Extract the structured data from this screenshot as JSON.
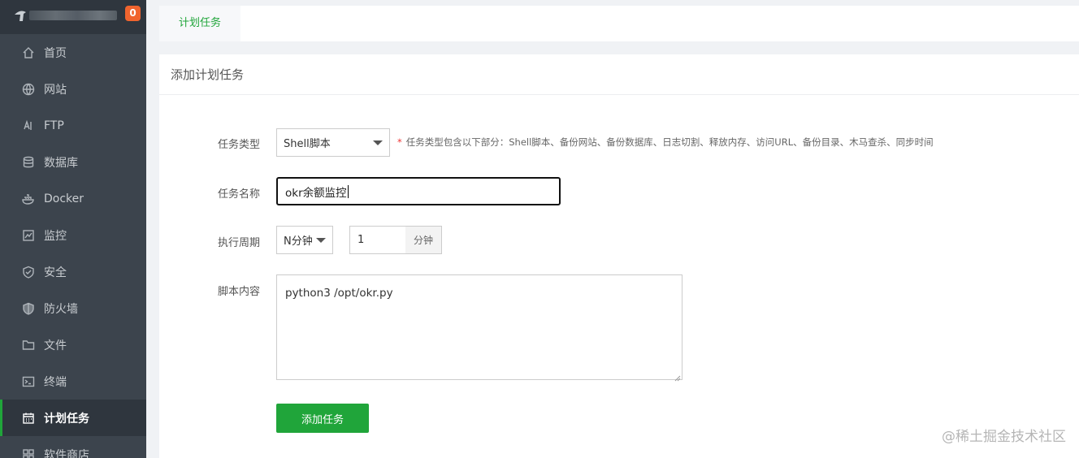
{
  "sidebar": {
    "badge": "0",
    "items": [
      {
        "label": "首页",
        "icon": "home-icon",
        "name": "sidebar-item-home"
      },
      {
        "label": "网站",
        "icon": "globe-icon",
        "name": "sidebar-item-website"
      },
      {
        "label": "FTP",
        "icon": "ftp-icon",
        "name": "sidebar-item-ftp"
      },
      {
        "label": "数据库",
        "icon": "database-icon",
        "name": "sidebar-item-database"
      },
      {
        "label": "Docker",
        "icon": "docker-icon",
        "name": "sidebar-item-docker"
      },
      {
        "label": "监控",
        "icon": "monitor-icon",
        "name": "sidebar-item-monitor"
      },
      {
        "label": "安全",
        "icon": "shield-check-icon",
        "name": "sidebar-item-security"
      },
      {
        "label": "防火墙",
        "icon": "shield-icon",
        "name": "sidebar-item-firewall"
      },
      {
        "label": "文件",
        "icon": "folder-icon",
        "name": "sidebar-item-files"
      },
      {
        "label": "终端",
        "icon": "terminal-icon",
        "name": "sidebar-item-terminal"
      },
      {
        "label": "计划任务",
        "icon": "calendar-icon",
        "name": "sidebar-item-cron",
        "active": true
      },
      {
        "label": "软件商店",
        "icon": "grid-icon",
        "name": "sidebar-item-store"
      }
    ]
  },
  "tabs": [
    {
      "label": "计划任务"
    }
  ],
  "panel": {
    "title": "添加计划任务",
    "task_type": {
      "label": "任务类型",
      "value": "Shell脚本",
      "hint": "任务类型包含以下部分：Shell脚本、备份网站、备份数据库、日志切割、释放内存、访问URL、备份目录、木马查杀、同步时间"
    },
    "task_name": {
      "label": "任务名称",
      "value": "okr余额监控"
    },
    "period": {
      "label": "执行周期",
      "type_value": "N分钟",
      "number_value": "1",
      "unit": "分钟"
    },
    "script": {
      "label": "脚本内容",
      "value": "python3 /opt/okr.py"
    },
    "submit_label": "添加任务"
  },
  "watermark": "@稀土掘金技术社区",
  "colors": {
    "accent": "#20a53a",
    "sidebar_bg": "#3c444d",
    "badge": "#f0642e"
  }
}
